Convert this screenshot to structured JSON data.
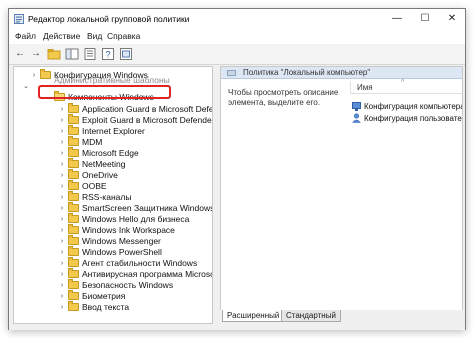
{
  "window": {
    "title": "Редактор локальной групповой политики"
  },
  "window_controls": {
    "minimize": "—",
    "maximize": "☐",
    "close": "✕"
  },
  "menu": [
    "Файл",
    "Действие",
    "Вид",
    "Справка"
  ],
  "toolbar": {
    "back": "←",
    "forward": "→"
  },
  "tree": {
    "root_item": "Конфигурация Windows",
    "clipped_item": "Административные шаблоны",
    "selected_item": "Компоненты Windows",
    "children": [
      "Application Guard в Microsoft Defender",
      "Exploit Guard в Microsoft Defender",
      "Internet Explorer",
      "MDM",
      "Microsoft Edge",
      "NetMeeting",
      "OneDrive",
      "OOBE",
      "RSS-каналы",
      "SmartScreen Защитника Windows",
      "Windows Hello для бизнеса",
      "Windows Ink Workspace",
      "Windows Messenger",
      "Windows PowerShell",
      "Агент стабильности Windows",
      "Антивирусная программа Microsoft Defender",
      "Безопасность Windows",
      "Биометрия",
      "Ввод текста"
    ]
  },
  "right_pane": {
    "header_title": "Политика \"Локальный компьютер\"",
    "description": "Чтобы просмотреть описание элемента, выделите его.",
    "column_name": "Имя",
    "column_sort": "^",
    "items": [
      "Конфигурация компьютера",
      "Конфигурация пользовате..."
    ]
  },
  "tabs": [
    "Расширенный",
    "Стандартный"
  ]
}
